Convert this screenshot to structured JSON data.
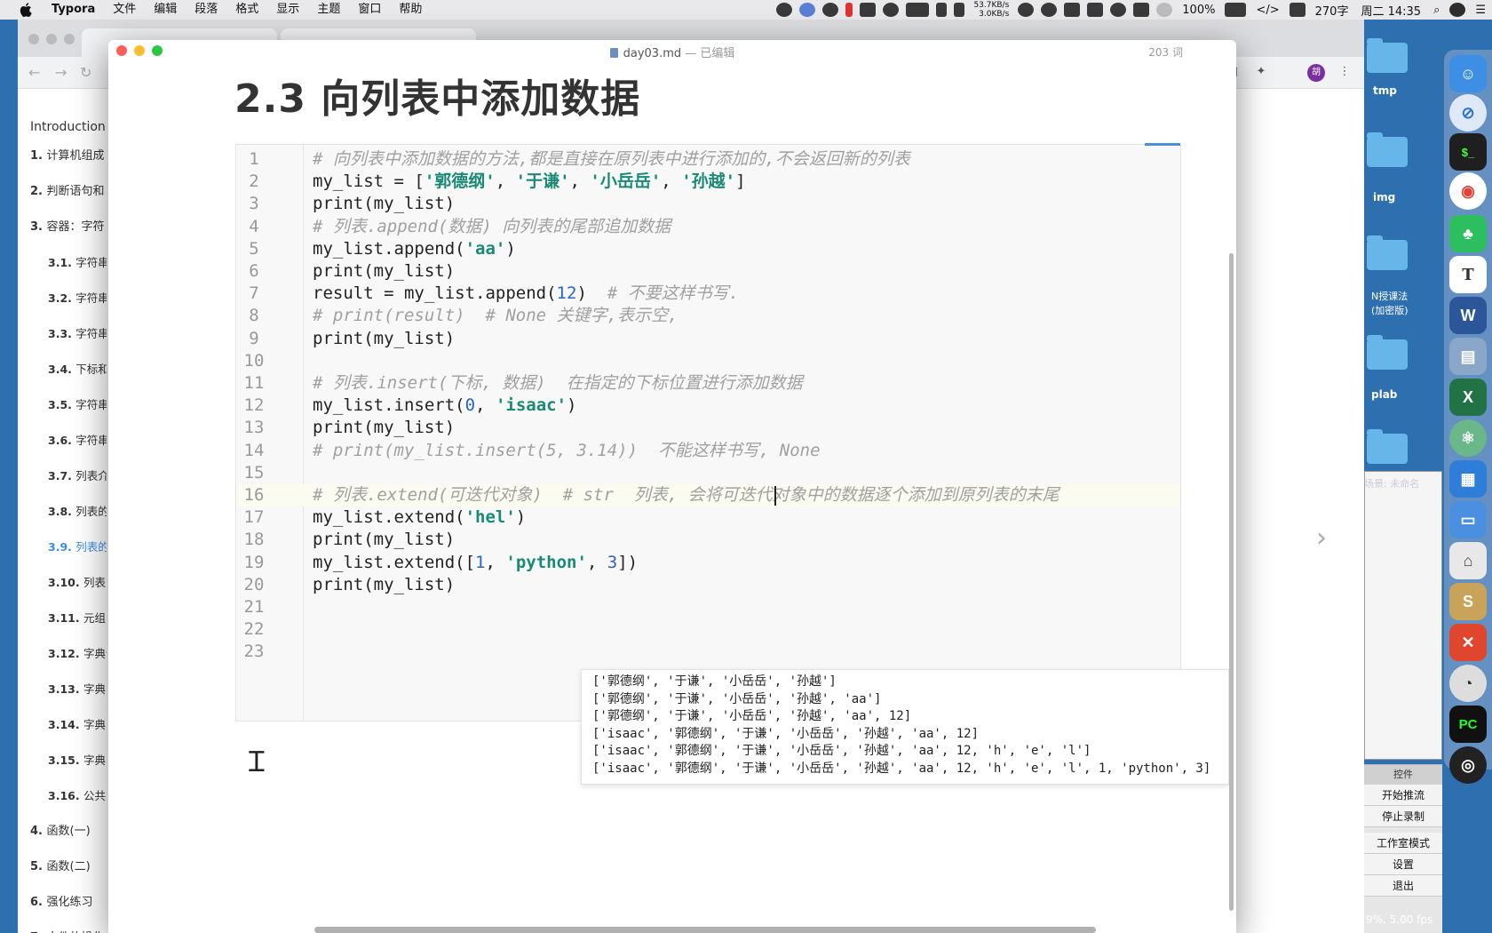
{
  "menubar": {
    "app": "Typora",
    "items": [
      "文件",
      "编辑",
      "段落",
      "格式",
      "显示",
      "主题",
      "窗口",
      "帮助"
    ],
    "net_up": "53.7KB/s",
    "net_down": "3.0KB/s",
    "battery": "100%",
    "word_chars": "270字",
    "datetime": "周二 14:35"
  },
  "toc": {
    "intro": "Introduction",
    "items": [
      {
        "num": "1.",
        "label": "计算机组成",
        "level": 1
      },
      {
        "num": "2.",
        "label": "判断语句和",
        "level": 1
      },
      {
        "num": "3.",
        "label": "容器：字符",
        "level": 1
      },
      {
        "num": "3.1.",
        "label": "字符串",
        "level": 2
      },
      {
        "num": "3.2.",
        "label": "字符串",
        "level": 2
      },
      {
        "num": "3.3.",
        "label": "字符串",
        "level": 2
      },
      {
        "num": "3.4.",
        "label": "下标和",
        "level": 2
      },
      {
        "num": "3.5.",
        "label": "字符串",
        "level": 2
      },
      {
        "num": "3.6.",
        "label": "字符串",
        "level": 2
      },
      {
        "num": "3.7.",
        "label": "列表介",
        "level": 2
      },
      {
        "num": "3.8.",
        "label": "列表的",
        "level": 2
      },
      {
        "num": "3.9.",
        "label": "列表的",
        "level": 2,
        "active": true
      },
      {
        "num": "3.10.",
        "label": "列表的",
        "level": 2
      },
      {
        "num": "3.11.",
        "label": "元组",
        "level": 2
      },
      {
        "num": "3.12.",
        "label": "字典介",
        "level": 2
      },
      {
        "num": "3.13.",
        "label": "字典的",
        "level": 2
      },
      {
        "num": "3.14.",
        "label": "字典的",
        "level": 2
      },
      {
        "num": "3.15.",
        "label": "字典的",
        "level": 2
      },
      {
        "num": "3.16.",
        "label": "公共方",
        "level": 2
      },
      {
        "num": "4.",
        "label": "函数(一)",
        "level": 1
      },
      {
        "num": "5.",
        "label": "函数(二)",
        "level": 1
      },
      {
        "num": "6.",
        "label": "强化练习",
        "level": 1
      },
      {
        "num": "7.",
        "label": "文件的操作",
        "level": 1
      }
    ]
  },
  "typora": {
    "filename": "day03.md",
    "status": " — 已编辑",
    "word_count": "203 词",
    "heading": "2.3 向列表中添加数据"
  },
  "code_lines": [
    "# 向列表中添加数据的方法,都是直接在原列表中进行添加的,不会返回新的列表",
    "my_list = ['郭德纲', '于谦', '小岳岳', '孙越']",
    "print(my_list)",
    "# 列表.append(数据) 向列表的尾部追加数据",
    "my_list.append('aa')",
    "print(my_list)",
    "result = my_list.append(12)  # 不要这样书写.",
    "# print(result)  # None 关键字,表示空,",
    "print(my_list)",
    "",
    "# 列表.insert(下标, 数据)  在指定的下标位置进行添加数据",
    "my_list.insert(0, 'isaac')",
    "print(my_list)",
    "# print(my_list.insert(5, 3.14))  不能这样书写, None",
    "",
    "# 列表.extend(可迭代对象)  # str  列表, 会将可迭代对象中的数据逐个添加到原列表的末尾",
    "my_list.extend('hel')",
    "print(my_list)",
    "my_list.extend([1, 'python', 3])",
    "print(my_list)",
    "",
    "",
    ""
  ],
  "output_lines": [
    "['郭德纲', '于谦', '小岳岳', '孙越']",
    "['郭德纲', '于谦', '小岳岳', '孙越', 'aa']",
    "['郭德纲', '于谦', '小岳岳', '孙越', 'aa', 12]",
    "['isaac', '郭德纲', '于谦', '小岳岳', '孙越', 'aa', 12]",
    "['isaac', '郭德纲', '于谦', '小岳岳', '孙越', 'aa', 12, 'h', 'e', 'l']",
    "['isaac', '郭德纲', '于谦', '小岳岳', '孙越', 'aa', 12, 'h', 'e', 'l', 1, 'python', 3]"
  ],
  "desktop": {
    "folders": [
      "tmp",
      "img",
      "N授课法\n(加密版)",
      "plab"
    ]
  },
  "obs": {
    "scene_label": "场景: 未命名",
    "header": "控件",
    "buttons": [
      "开始推流",
      "停止录制",
      "工作室模式",
      "设置",
      "退出"
    ],
    "fps": "9%, 5.00 fps"
  },
  "browser": {
    "avatar": "胡"
  },
  "dock_icons": [
    "finder-icon",
    "safari-icon",
    "terminal-icon",
    "chrome-icon",
    "evernote-icon",
    "typora-icon",
    "word-icon",
    "preview-icon",
    "excel-icon",
    "atom-icon",
    "pycharm-icon",
    "obs-icon"
  ]
}
